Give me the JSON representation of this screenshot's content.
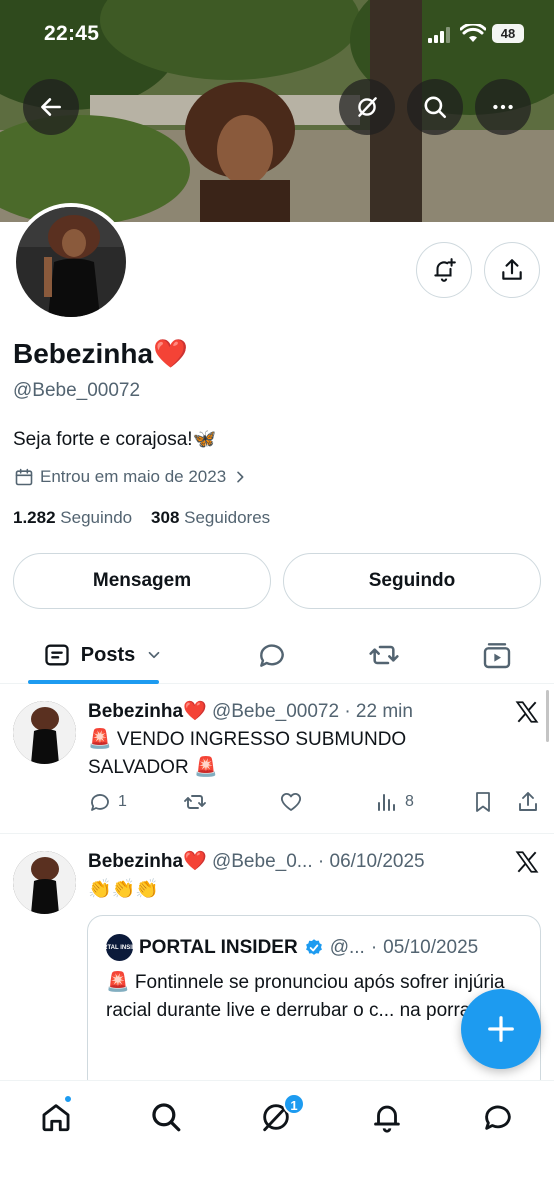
{
  "status_bar": {
    "time": "22:45",
    "battery": "48"
  },
  "profile": {
    "name": "Bebezinha❤️",
    "handle": "@Bebe_00072",
    "bio": "Seja forte e corajosa!🦋",
    "joined": "Entrou em maio de 2023",
    "following_count": "1.282",
    "following_label": "Seguindo",
    "followers_count": "308",
    "followers_label": "Seguidores"
  },
  "buttons": {
    "message": "Mensagem",
    "following": "Seguindo"
  },
  "tabs": {
    "posts": "Posts"
  },
  "posts": [
    {
      "name": "Bebezinha❤️",
      "handle": "@Bebe_00072",
      "dot": "·",
      "time": "22 min",
      "text_line1": "🚨 VENDO INGRESSO SUBMUNDO",
      "text_line2": "SALVADOR 🚨",
      "replies": "1",
      "views": "8"
    },
    {
      "name": "Bebezinha❤️",
      "handle": "@Bebe_0...",
      "dot": "·",
      "time": "06/10/2025",
      "text": "👏👏👏",
      "quote": {
        "logo_text": "PORTAL INSIDER",
        "name": "PORTAL INSIDER",
        "handle": "@...",
        "dot": "·",
        "time": "05/10/2025",
        "text": "🚨 Fontinnele se pronunciou após sofrer injúria racial durante live e derrubar o c... na porrada!"
      }
    }
  ],
  "nav": {
    "messages_badge": "1"
  },
  "colors": {
    "accent": "#1d9bf0",
    "text": "#0f1419",
    "muted": "#536471",
    "border": "#cfd9de"
  },
  "icons": [
    "back-arrow-icon",
    "hide-icon",
    "search-icon",
    "more-icon",
    "bell-plus-icon",
    "share-icon",
    "calendar-icon",
    "chevron-right-icon",
    "posts-icon",
    "chevron-down-icon",
    "reply-icon",
    "repost-icon",
    "media-icon",
    "x-logo-icon",
    "like-icon",
    "views-icon",
    "bookmark-icon",
    "plus-icon",
    "home-icon",
    "grok-icon",
    "notifications-icon",
    "chat-icon",
    "verified-badge-icon"
  ]
}
